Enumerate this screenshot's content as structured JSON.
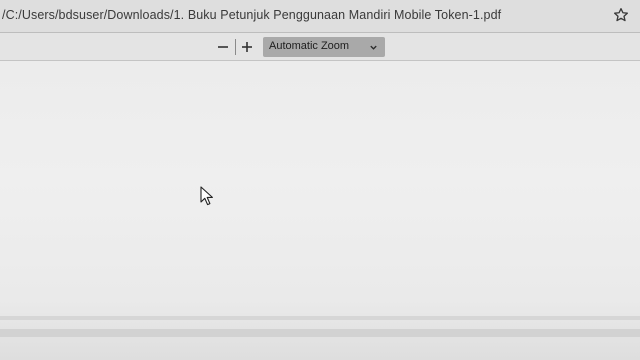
{
  "browser": {
    "url": "/C:/Users/bdsuser/Downloads/1. Buku Petunjuk Penggunaan Mandiri Mobile Token-1.pdf",
    "bookmark_icon": "star-icon"
  },
  "pdf_toolbar": {
    "zoom_out_icon": "minus-icon",
    "zoom_in_icon": "plus-icon",
    "zoom_select_value": "Automatic Zoom",
    "dropdown_icon": "chevron-down-icon"
  },
  "viewer": {
    "cursor_icon": "mouse-pointer-icon"
  }
}
